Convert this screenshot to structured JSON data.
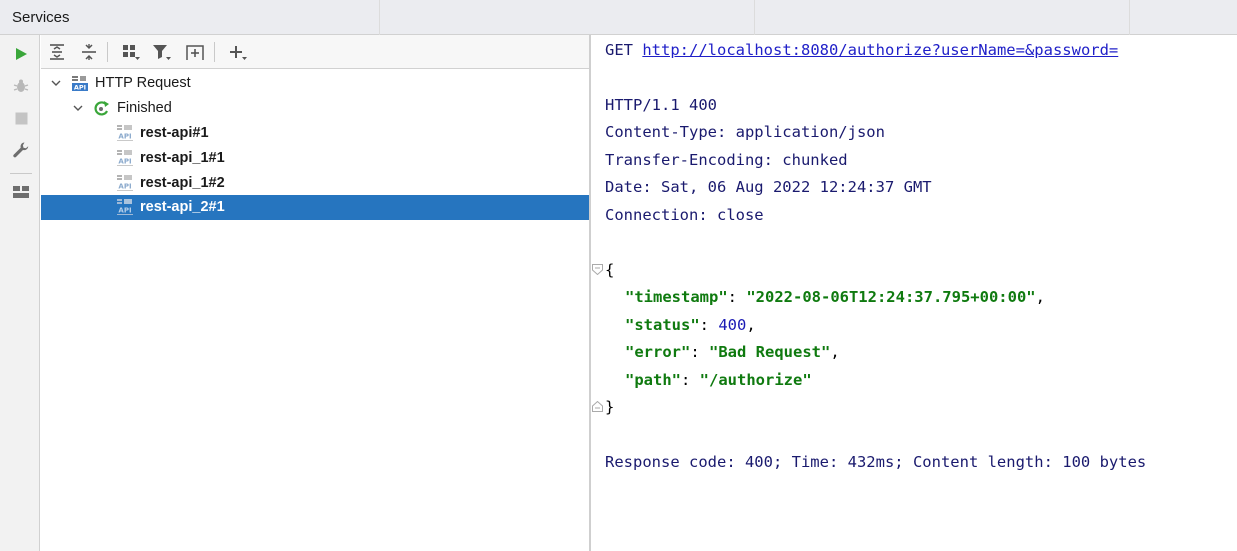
{
  "window": {
    "title": "Services"
  },
  "toolbar": {
    "run_icon": "run-icon",
    "debug_icon": "debug-icon",
    "stop_icon": "stop-icon",
    "settings_icon": "wrench-icon",
    "layout_icon": "layout-icon",
    "expand_all_icon": "expand-all-icon",
    "collapse_all_icon": "collapse-all-icon",
    "group_icon": "group-icon",
    "filter_icon": "filter-icon",
    "new_tab_icon": "new-tab-icon",
    "add_icon": "add-icon"
  },
  "tree": {
    "root": {
      "label": "HTTP Request",
      "icon": "api-icon"
    },
    "group": {
      "label": "Finished",
      "icon": "rerun-icon"
    },
    "items": [
      {
        "label": "rest-api#1",
        "selected": false
      },
      {
        "label": "rest-api_1#1",
        "selected": false
      },
      {
        "label": "rest-api_1#2",
        "selected": false
      },
      {
        "label": "rest-api_2#1",
        "selected": true
      }
    ]
  },
  "response": {
    "method": "GET",
    "url": "http://localhost:8080/authorize?userName=&password=",
    "status_line": "HTTP/1.1 400",
    "headers": [
      "Content-Type: application/json",
      "Transfer-Encoding: chunked",
      "Date: Sat, 06 Aug 2022 12:24:37 GMT",
      "Connection: close"
    ],
    "body": {
      "open_brace": "{",
      "close_brace": "}",
      "fields": [
        {
          "key": "\"timestamp\"",
          "value": "\"2022-08-06T12:24:37.795+00:00\"",
          "type": "string",
          "comma": ","
        },
        {
          "key": "\"status\"",
          "value": "400",
          "type": "number",
          "comma": ","
        },
        {
          "key": "\"error\"",
          "value": "\"Bad Request\"",
          "type": "string",
          "comma": ","
        },
        {
          "key": "\"path\"",
          "value": "\"/authorize\"",
          "type": "string",
          "comma": ""
        }
      ]
    },
    "summary": "Response code: 400; Time: 432ms; Content length: 100 bytes"
  },
  "colors": {
    "selection": "#2675bf",
    "run_green": "#3aa63a",
    "json_string": "#0f7a0f",
    "json_number": "#1a1ab5",
    "text_blue": "#1a1a6e"
  }
}
